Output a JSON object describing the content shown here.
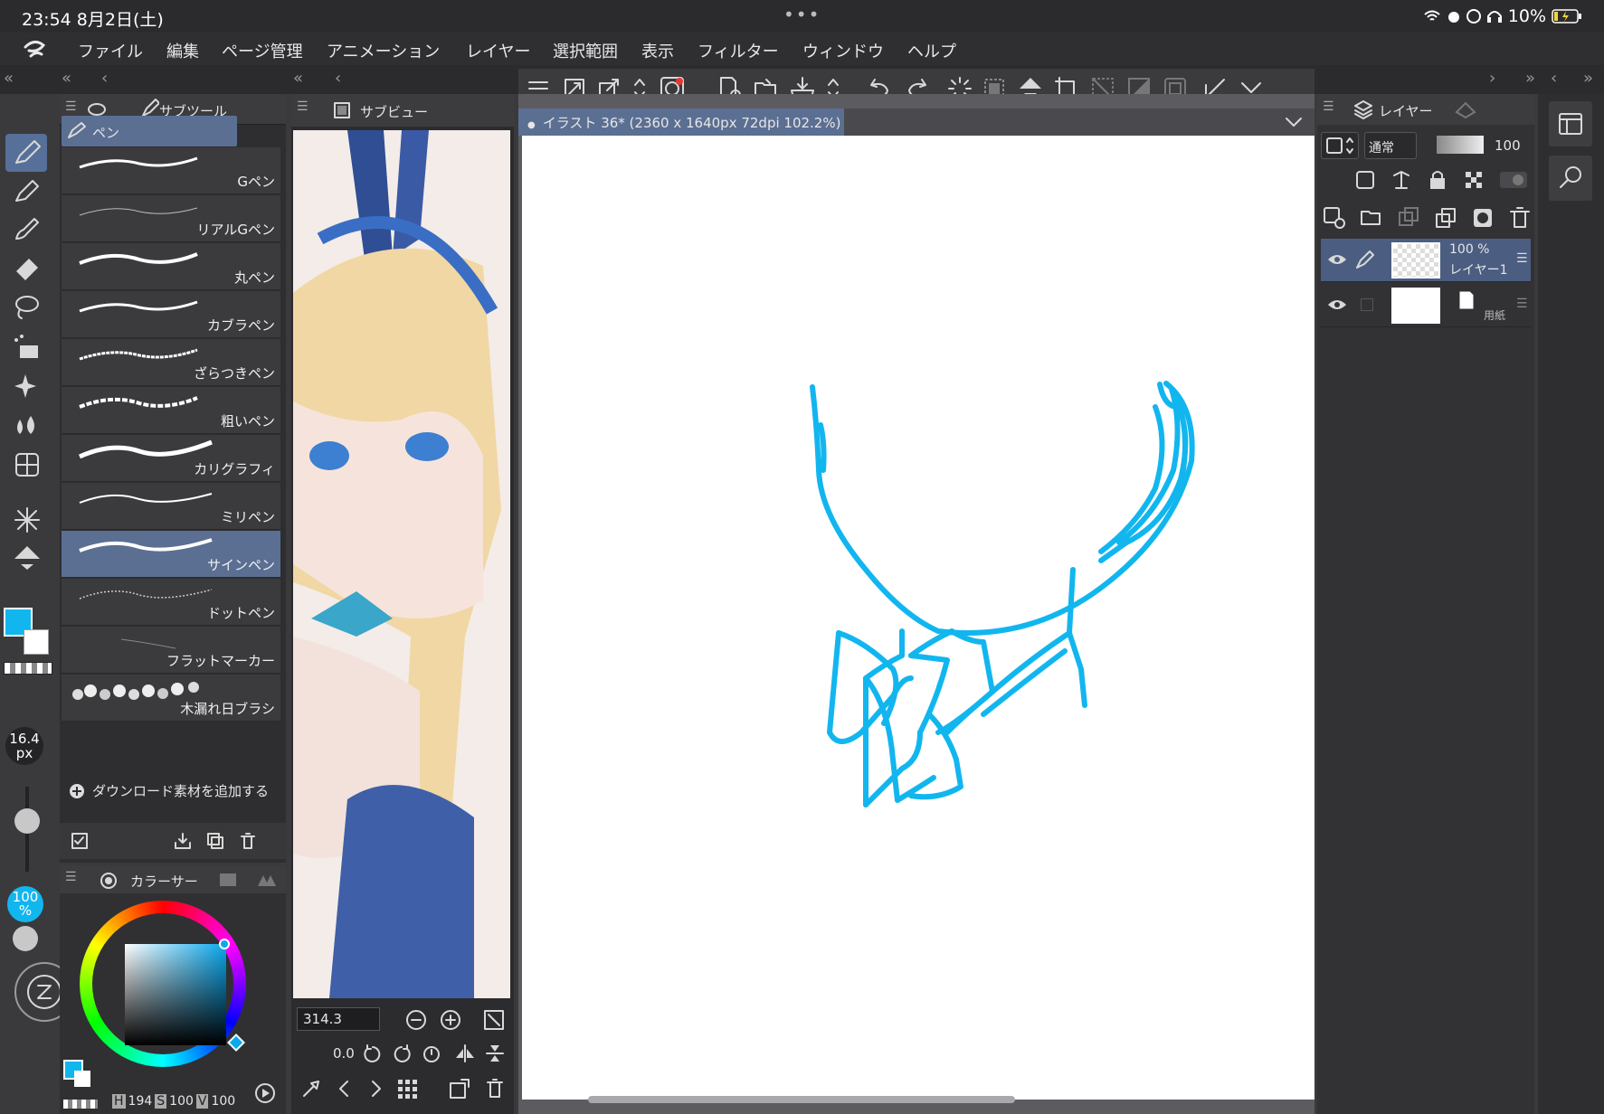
{
  "status_bar": {
    "time_date": "23:54  8月2日(土)",
    "dots": "•••",
    "battery": "10%"
  },
  "menu": {
    "items": [
      "ファイル",
      "編集",
      "ページ管理",
      "アニメーション",
      "レイヤー",
      "選択範囲",
      "表示",
      "フィルター",
      "ウィンドウ",
      "ヘルプ"
    ]
  },
  "subtool_panel": {
    "tab_label": "サブツール",
    "group_label": "ペン",
    "items": [
      {
        "label": "Gペン"
      },
      {
        "label": "リアルGペン"
      },
      {
        "label": "丸ペン"
      },
      {
        "label": "カブラペン"
      },
      {
        "label": "ざらつきペン"
      },
      {
        "label": "粗いペン"
      },
      {
        "label": "カリグラフィ"
      },
      {
        "label": "ミリペン"
      },
      {
        "label": "サインペン"
      },
      {
        "label": "ドットペン"
      },
      {
        "label": "フラットマーカー"
      },
      {
        "label": "木漏れ日ブラシ"
      }
    ],
    "selected_index": 8,
    "add_download": "ダウンロード素材を追加する"
  },
  "brush": {
    "size_value": "16.4",
    "size_unit": "px",
    "opacity_value": "100",
    "opacity_unit": "%"
  },
  "color_panel": {
    "tab_label": "カラーサー",
    "hsv_h_label": "H",
    "hsv_h": "194",
    "hsv_s_label": "S",
    "hsv_s": "100",
    "hsv_v_label": "V",
    "hsv_v": "100",
    "main_color": "#0aa8ee",
    "sub_color": "#ffffff"
  },
  "subview": {
    "tab_label": "サブビュー",
    "zoom": "314.3",
    "rotation": "0.0"
  },
  "document": {
    "tab_title": "イラスト 36* (2360 x 1640px 72dpi 102.2%)"
  },
  "layer_panel": {
    "tab_label": "レイヤー",
    "blend_mode": "通常",
    "opacity": "100",
    "layers": [
      {
        "opacity": "100 %",
        "name": "レイヤー1",
        "selected": true
      },
      {
        "opacity": "",
        "name": "用紙",
        "selected": false
      }
    ]
  },
  "colors": {
    "stroke": "#12b6ef",
    "accent": "#5b6f93"
  }
}
